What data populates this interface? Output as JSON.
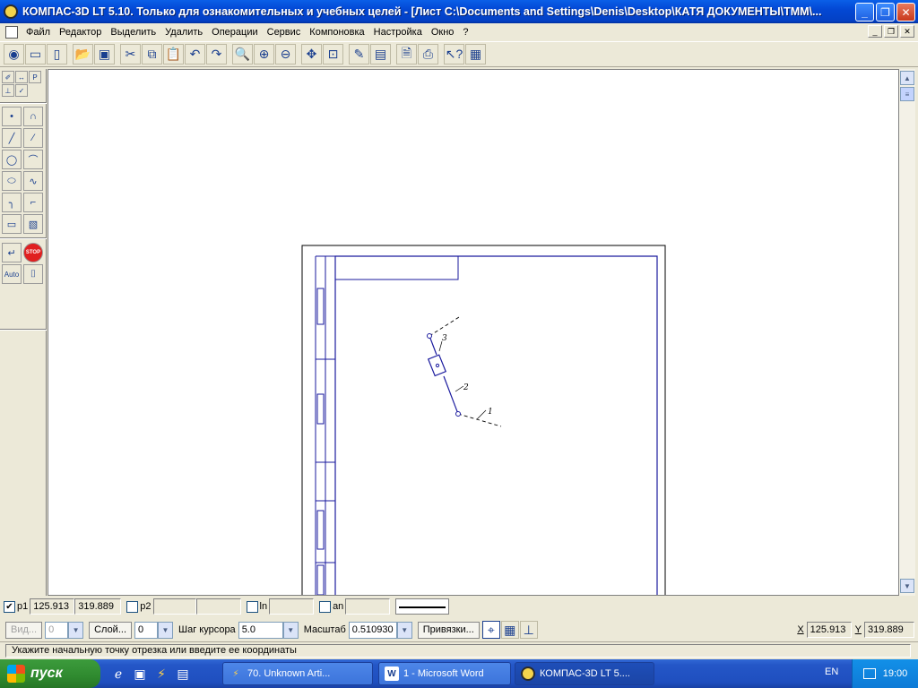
{
  "titlebar": {
    "title": "КОМПАС-3D LT 5.10. Только для ознакомительных и учебных целей - [Лист C:\\Documents and Settings\\Denis\\Desktop\\КАТЯ ДОКУМЕНТЫ\\ТММ\\..."
  },
  "menubar": {
    "items": [
      "Файл",
      "Редактор",
      "Выделить",
      "Удалить",
      "Операции",
      "Сервис",
      "Компоновка",
      "Настройка",
      "Окно",
      "?"
    ]
  },
  "leftpanel": {
    "tab_p": "P",
    "auto_label": "Auto",
    "stop_label": "STOP"
  },
  "drawing": {
    "labels": [
      "1",
      "2",
      "3"
    ]
  },
  "coordbar": {
    "p1_label": "p1",
    "p1_x": "125.913",
    "p1_y": "319.889",
    "p2_label": "p2",
    "ln_label": "ln",
    "an_label": "an"
  },
  "propbar": {
    "view_button": "Вид...",
    "view_value": "0",
    "layer_button": "Слой...",
    "layer_value": "0",
    "cursor_step_label": "Шаг курсора",
    "cursor_step_value": "5.0",
    "scale_label": "Масштаб",
    "scale_value": "0.510930",
    "snaps_button": "Привязки...",
    "x_label": "X",
    "x_value": "125.913",
    "y_label": "Y",
    "y_value": "319.889"
  },
  "status": {
    "text": "Укажите начальную точку отрезка или введите ее координаты"
  },
  "taskbar": {
    "start_label": "пуск",
    "tasks": [
      "70. Unknown Arti...",
      "1 - Microsoft Word",
      "КОМПАС-3D LT 5...."
    ],
    "lang": "EN",
    "clock": "19:00"
  },
  "colors": {
    "drawing_line": "#1a1a9e",
    "canvas_bg": "#ffffff",
    "titlebar": "#0348d4"
  }
}
